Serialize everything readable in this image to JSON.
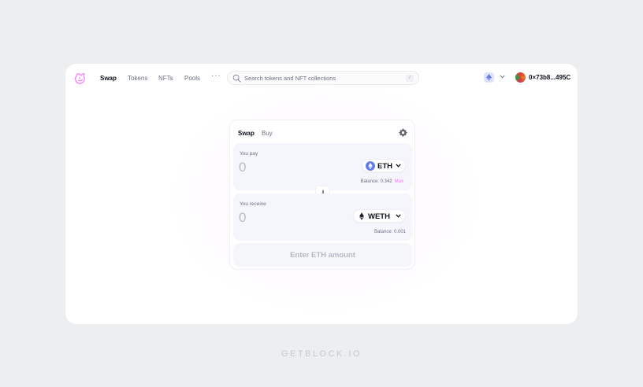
{
  "nav": {
    "links": [
      {
        "label": "Swap",
        "active": true
      },
      {
        "label": "Tokens",
        "active": false
      },
      {
        "label": "NFTs",
        "active": false
      },
      {
        "label": "Pools",
        "active": false
      }
    ],
    "more_label": "···",
    "search": {
      "placeholder": "Search tokens and NFT collections",
      "value": "",
      "shortcut": "/"
    },
    "network_icon": "ethereum-icon",
    "wallet": {
      "address": "0×73b8...495C",
      "avatar": "wallet-avatar"
    }
  },
  "swap": {
    "tabs": {
      "swap": "Swap",
      "buy": "Buy"
    },
    "pay": {
      "label": "You pay",
      "amount_placeholder": "0",
      "token": "ETH",
      "balance_label": "Balance: 0.342",
      "max_label": "Max"
    },
    "receive": {
      "label": "You receive",
      "amount_placeholder": "0",
      "token": "WETH",
      "balance_label": "Balance: 0.001"
    },
    "cta_label": "Enter ETH amount"
  },
  "footer": {
    "brand": "GETBLOCK.IO"
  },
  "colors": {
    "accent": "#fc72ff",
    "eth_blue": "#627eea",
    "background": "#eceef0"
  }
}
